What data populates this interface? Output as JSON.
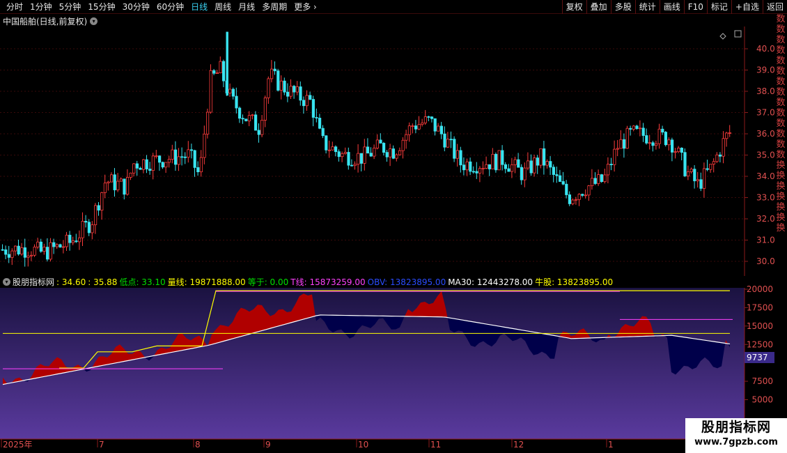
{
  "toolbar": {
    "periods": [
      "分时",
      "1分钟",
      "5分钟",
      "15分钟",
      "30分钟",
      "60分钟",
      "日线",
      "周线",
      "月线",
      "多周期",
      "更多"
    ],
    "active_period": "日线",
    "tools": [
      "复权",
      "叠加",
      "多股",
      "统计",
      "画线",
      "F10",
      "标记",
      "+自选",
      "返回"
    ]
  },
  "chart": {
    "title": "中国船舶(日线,前复权)",
    "price_ticks": [
      "40.00",
      "39.00",
      "38.00",
      "37.00",
      "36.00",
      "35.00",
      "34.00",
      "33.00",
      "32.00",
      "31.00",
      "30.00"
    ]
  },
  "indicator": {
    "name": "股朋指标网",
    "v1": ": 34.60",
    "v2": ": 35.88",
    "low_label": "低点: 33.10",
    "volume_line": "量线: 19871888.00",
    "equal": "等于: 0.00",
    "t_line": "T线: 15873259.00",
    "obv": "OBV: 13823895.00",
    "ma30": "MA30: 12443278.00",
    "bull": "牛股: 13823895.00",
    "y_ticks": [
      "20000",
      "17500",
      "15000",
      "12500",
      "7500",
      "5000"
    ],
    "current_value": "9737",
    "colors": {
      "yellow": "#ffff00",
      "green": "#00e000",
      "magenta": "#ff40ff",
      "blue": "#2040ff",
      "white": "#ffffff",
      "red": "#b00000",
      "navy": "#00004a"
    }
  },
  "time_axis": [
    "2025年",
    "7",
    "8",
    "9",
    "10",
    "11",
    "12",
    "1"
  ],
  "side_strip": "数数数数数数数数数数数数数数换换换换换换换",
  "watermark": {
    "title": "股朋指标网",
    "url": "www.7gpzb.com"
  }
}
